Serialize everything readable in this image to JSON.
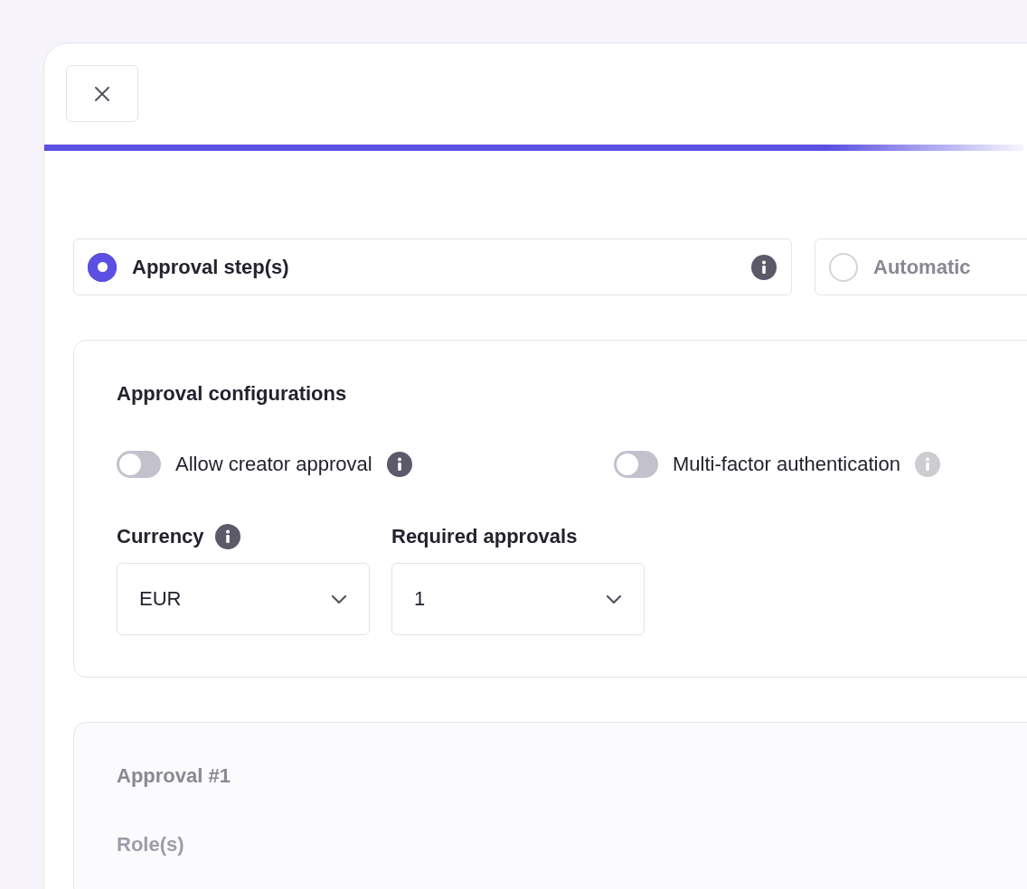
{
  "progress": {
    "level": 0.96
  },
  "approval_modes": [
    {
      "label": "Approval step(s)",
      "selected": true,
      "info": true
    },
    {
      "label": "Automatic",
      "selected": false,
      "info": false
    }
  ],
  "configuration": {
    "title": "Approval configurations",
    "toggles": [
      {
        "label": "Allow creator approval",
        "on": false,
        "info": true
      },
      {
        "label": "Multi-factor authentication",
        "on": false,
        "info": true
      }
    ],
    "selects": [
      {
        "label": "Currency",
        "info": true,
        "value": "EUR"
      },
      {
        "label": "Required approvals",
        "info": false,
        "value": "1"
      }
    ]
  },
  "approvals": [
    {
      "title": "Approval #1",
      "field_label": "Role(s)"
    }
  ]
}
